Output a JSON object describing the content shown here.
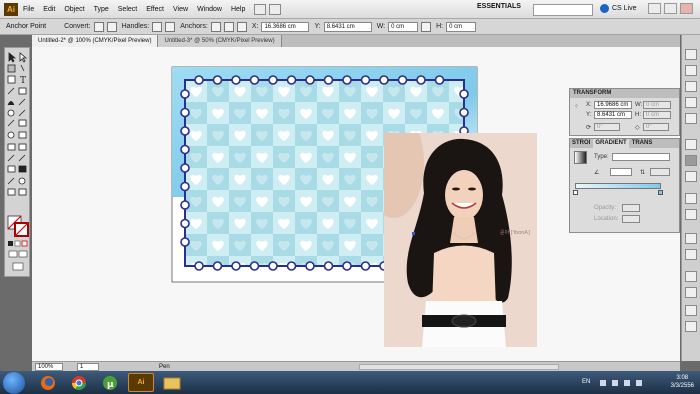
{
  "menubar": {
    "logo": "Ai",
    "items": [
      "File",
      "Edit",
      "Object",
      "Type",
      "Select",
      "Effect",
      "View",
      "Window",
      "Help"
    ],
    "workspace": "ESSENTIALS",
    "cslive": "CS Live"
  },
  "control": {
    "selection": "Anchor Point",
    "convert_label": "Convert:",
    "handles_label": "Handles:",
    "anchors_label": "Anchors:",
    "x_label": "X:",
    "x_value": "16.3686 cm",
    "y_label": "Y:",
    "y_value": "8.6431 cm",
    "w_label": "W:",
    "w_value": "0 cm",
    "h_label": "H:",
    "h_value": "0 cm"
  },
  "tabs": [
    {
      "label": "Untitled-2* @ 100% (CMYK/Pixel Preview)"
    },
    {
      "label": "Untitled-3* @ 50% (CMYK/Pixel Preview)"
    }
  ],
  "transform_panel": {
    "title": "TRANSFORM",
    "x_label": "X:",
    "x_value": "16.9686 cm",
    "y_label": "Y:",
    "y_value": "8.6431 cm",
    "w_label": "W:",
    "w_value": "0 cm",
    "h_label": "H:",
    "h_value": "0 cm",
    "angle_value": "0°",
    "shear_value": "0°"
  },
  "gradient_panel": {
    "tabs": [
      "STROI",
      "GRADIENT",
      "TRANS"
    ],
    "type_label": "Type:",
    "type_value": "",
    "opacity_label": "Opacity:",
    "location_label": "Location:"
  },
  "photo": {
    "caption": "윤아 [YoonA]"
  },
  "statusbar": {
    "zoom": "100%",
    "page": "1",
    "tool": "Pen"
  },
  "taskbar": {
    "language": "EN",
    "time": "3:08",
    "date": "3/3/2556",
    "apps": [
      "Firefox",
      "Chrome",
      "uTorrent",
      "Ai",
      "Explorer"
    ]
  },
  "colors": {
    "stamp_border": "#2a2e8c",
    "stamp_light": "#cfeef4",
    "stamp_dark": "#a9dbe6",
    "heart": "#ffffff"
  }
}
